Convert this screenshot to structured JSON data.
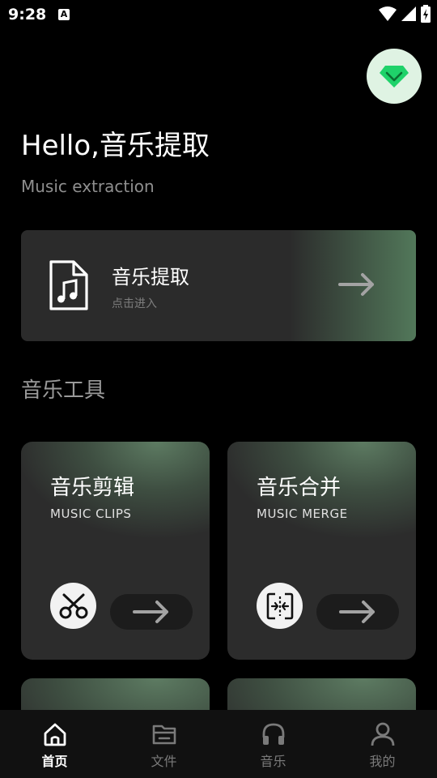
{
  "status_bar": {
    "time": "9:28",
    "notification": "A"
  },
  "header": {
    "greeting": "Hello,音乐提取",
    "subtitle": "Music extraction"
  },
  "extract_card": {
    "title": "音乐提取",
    "hint": "点击进入"
  },
  "tools_section": {
    "title": "音乐工具",
    "cards": [
      {
        "title": "音乐剪辑",
        "subtitle": "MUSIC CLIPS",
        "icon": "scissors-icon"
      },
      {
        "title": "音乐合并",
        "subtitle": "MUSIC MERGE",
        "icon": "merge-icon"
      }
    ]
  },
  "bottom_nav": {
    "items": [
      {
        "label": "首页",
        "icon": "home-icon",
        "active": true
      },
      {
        "label": "文件",
        "icon": "folder-icon",
        "active": false
      },
      {
        "label": "音乐",
        "icon": "headphones-icon",
        "active": false
      },
      {
        "label": "我的",
        "icon": "person-icon",
        "active": false
      }
    ]
  },
  "colors": {
    "accent": "#2ecc71",
    "background": "#000000",
    "card": "#2b2b2b",
    "muted_text": "#8f8f8f"
  }
}
